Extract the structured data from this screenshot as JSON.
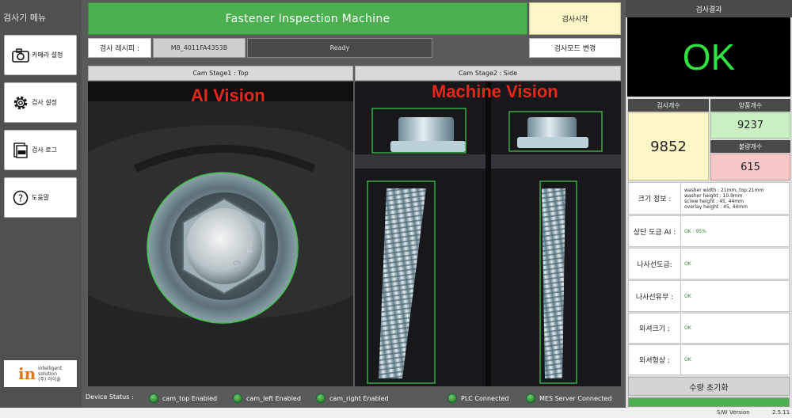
{
  "sidebar": {
    "title": "검사기 메뉴",
    "items": [
      {
        "label": "카메라 설정",
        "icon": "camera-icon"
      },
      {
        "label": "검사 설정",
        "icon": "gear-icon"
      },
      {
        "label": "검사 로그",
        "icon": "log-icon"
      },
      {
        "label": "도움말",
        "icon": "help-icon"
      }
    ],
    "logo": {
      "mark": "in",
      "line1": "intelligent",
      "line2": "solution",
      "line3": "(주) 아이솔"
    }
  },
  "header": {
    "title": "Fastener Inspection Machine",
    "start_button": "검사시작",
    "recipe_label": "검사 레시피 :",
    "recipe_value": "M8_4011FA4353B",
    "status": "Ready",
    "mode_button": "검사모드 변경"
  },
  "cameras": {
    "stage1": {
      "title": "Cam Stage1 : Top",
      "label": "AI Vision"
    },
    "stage2": {
      "title": "Cam Stage2 : Side",
      "label": "Machine Vision"
    }
  },
  "device_status": {
    "label": "Device Status :",
    "items": [
      {
        "label": "cam_top Enabled"
      },
      {
        "label": "cam_left Enabled"
      },
      {
        "label": "cam_right Enabled"
      },
      {
        "label": "PLC Connected"
      },
      {
        "label": "MES Server Connected"
      }
    ]
  },
  "results": {
    "title": "검사결과",
    "verdict": "OK",
    "total_label": "검사개수",
    "total": "9852",
    "good_label": "양품개수",
    "good": "9237",
    "bad_label": "불량개수",
    "bad": "615",
    "rows": [
      {
        "label": "크기 정보 :",
        "lines": [
          "washer width        : 21mm, top:21mm",
          "washer height        : 10.9mm",
          "screw height         : 45, 44mm",
          "overlay height        : 45, 44mm"
        ]
      },
      {
        "label": "상단 도금 AI :",
        "value": "OK : 95%"
      },
      {
        "label": "나사선도금:",
        "value": "OK"
      },
      {
        "label": "나사선유무 :",
        "value": "OK"
      },
      {
        "label": "와셔크기 :",
        "value": "OK"
      },
      {
        "label": "와셔형상 :",
        "value": "OK"
      }
    ],
    "reset_button": "수량 초기화",
    "progress": 1.0
  },
  "footer": {
    "version_label": "S/W Version",
    "version": "2.5.11"
  },
  "colors": {
    "accent_green": "#4caf50",
    "ok_green": "#2ee33f",
    "vision_red": "#e8261a",
    "box_green": "#3fc24a"
  }
}
